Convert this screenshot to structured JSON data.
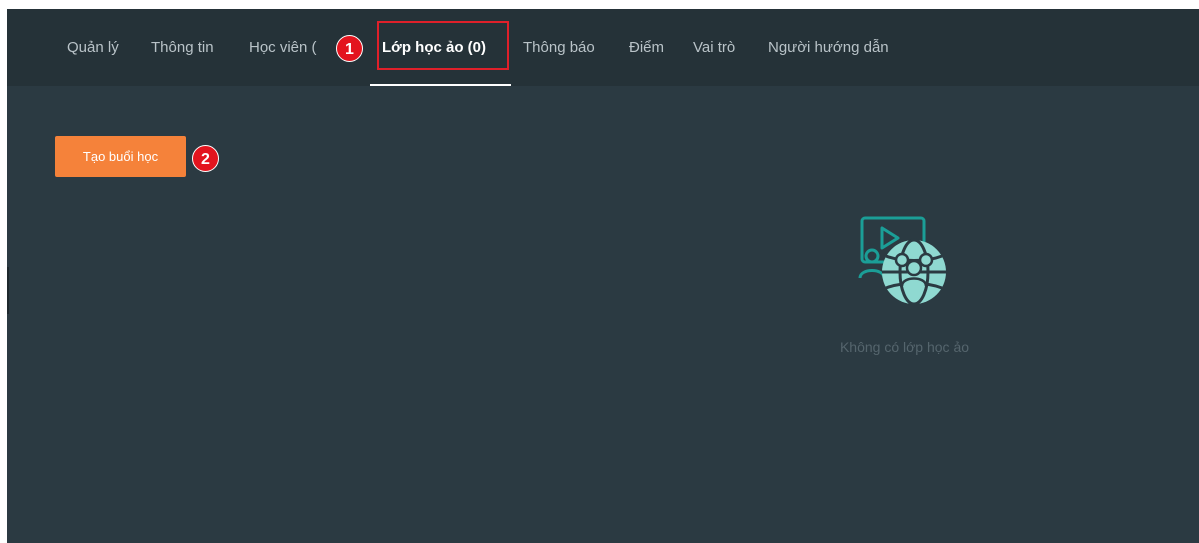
{
  "tabs": [
    {
      "label": "Quản lý"
    },
    {
      "label": "Thông tin"
    },
    {
      "label": "Học viên ("
    },
    {
      "label": "Lớp học ảo (0)",
      "active": true
    },
    {
      "label": "Thông báo"
    },
    {
      "label": "Điểm"
    },
    {
      "label": "Vai trò"
    },
    {
      "label": "Người hướng dẫn"
    }
  ],
  "annotations": {
    "step1": "1",
    "step2": "2",
    "highlight_color": "#e0202a"
  },
  "actions": {
    "create_session_label": "Tạo buổi học"
  },
  "empty_state": {
    "icon": "virtual-classroom-icon",
    "message": "Không có lớp học ảo"
  },
  "colors": {
    "background": "#2b3a42",
    "header": "#253238",
    "accent_button": "#f5823a",
    "icon_teal": "#1b9e97"
  }
}
